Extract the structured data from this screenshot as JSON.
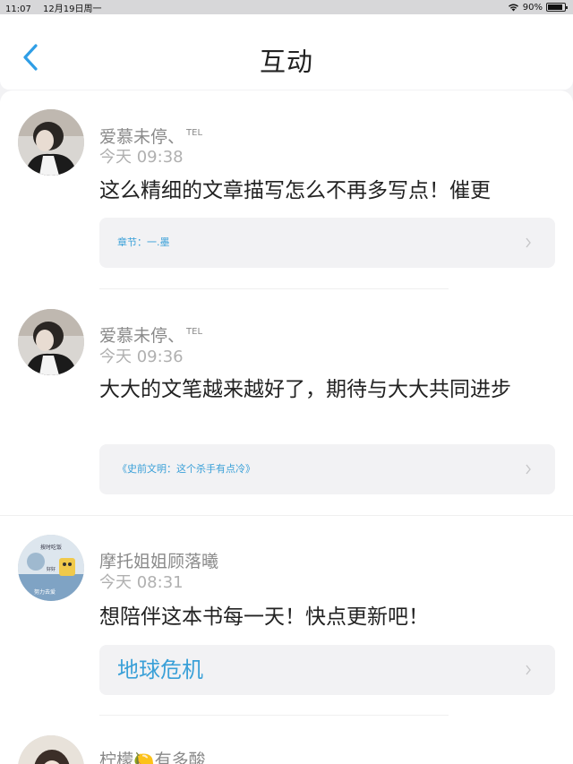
{
  "status_bar": {
    "time": "11:07",
    "date": "12月19日周一",
    "battery": "90%",
    "battery_level": 0.9
  },
  "header": {
    "title": "互动"
  },
  "comments": [
    {
      "user": "爱慕未停、",
      "tag": "TEL",
      "time": "今天 09:38",
      "text": "这么精细的文章描写怎么不再多写点！催更",
      "link": "章节：一.墨"
    },
    {
      "user": "爱慕未停、",
      "tag": "TEL",
      "time": "今天 09:36",
      "text": "大大的文笔越来越好了，期待与大大共同进步",
      "link": "《史前文明：这个杀手有点冷》"
    },
    {
      "user": "摩托姐姐顾落曦",
      "time": "今天 08:31",
      "text": "想陪伴这本书每一天！快点更新吧！",
      "link": "地球危机",
      "avatar_text": [
        "按时吃饭",
        "好好",
        "努力去爱"
      ]
    },
    {
      "user": "柠檬🍋有多酸"
    }
  ]
}
